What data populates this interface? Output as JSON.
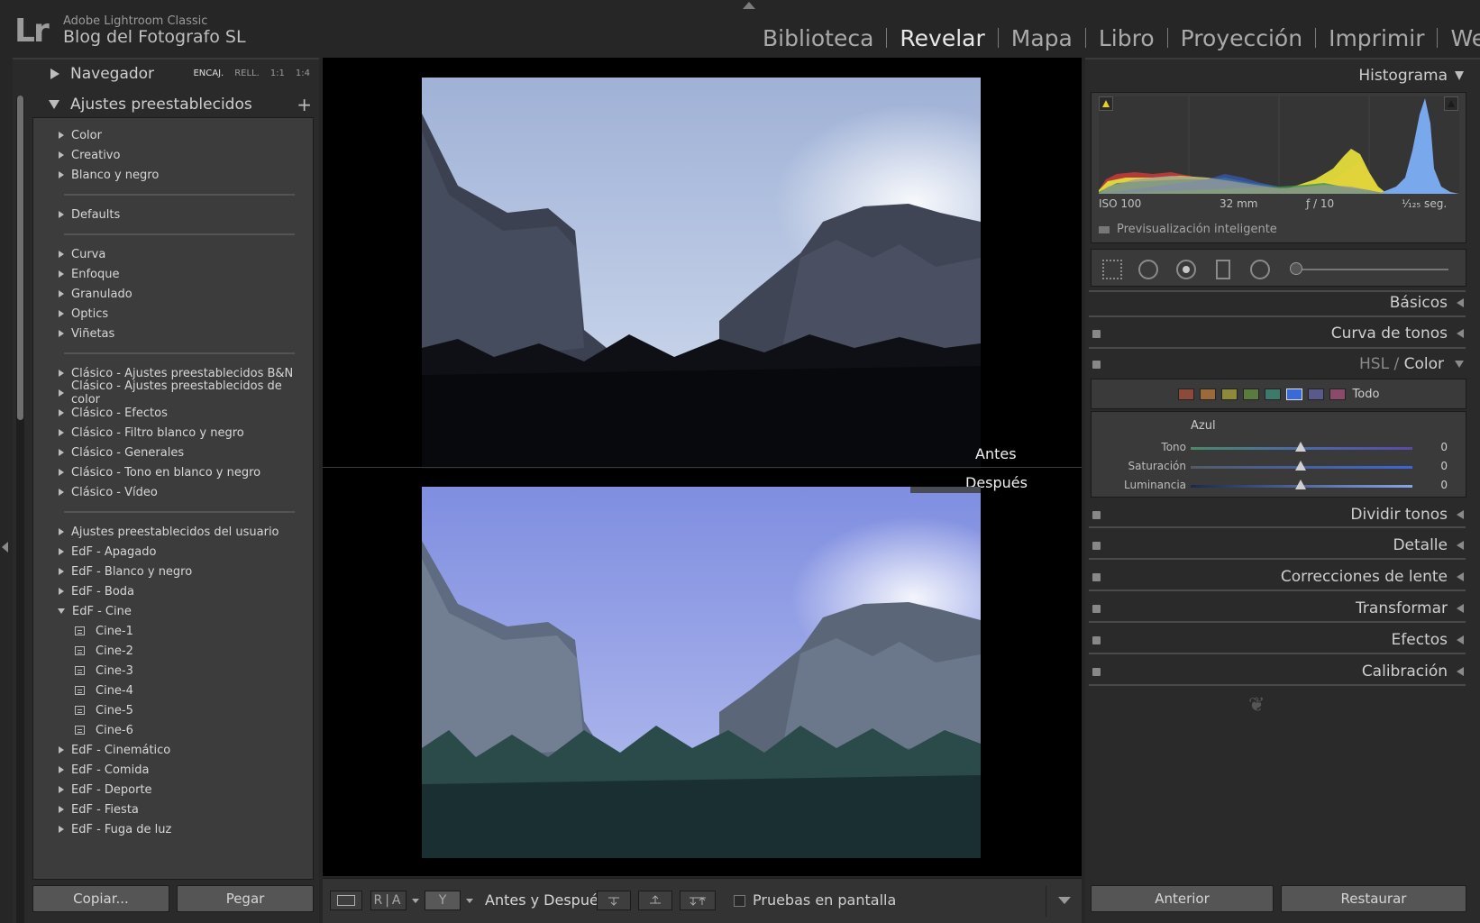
{
  "app": {
    "logo": "Lr",
    "name": "Adobe Lightroom Classic",
    "catalog": "Blog del Fotografo SL"
  },
  "modules": [
    {
      "label": "Biblioteca",
      "active": false
    },
    {
      "label": "Revelar",
      "active": true
    },
    {
      "label": "Mapa",
      "active": false
    },
    {
      "label": "Libro",
      "active": false
    },
    {
      "label": "Proyección",
      "active": false
    },
    {
      "label": "Imprimir",
      "active": false
    },
    {
      "label": "Web",
      "active": false
    }
  ],
  "left": {
    "navigator": {
      "title": "Navegador",
      "zoom_options": [
        "ENCAJ.",
        "RELL.",
        "1:1",
        "1:4"
      ]
    },
    "presets": {
      "title": "Ajustes preestablecidos",
      "plus": "+",
      "groups": [
        [
          "Color",
          "Creativo",
          "Blanco y negro"
        ],
        [
          "Defaults"
        ],
        [
          "Curva",
          "Enfoque",
          "Granulado",
          "Optics",
          "Viñetas"
        ],
        [
          "Clásico - Ajustes preestablecidos B&N",
          "Clásico - Ajustes preestablecidos de color",
          "Clásico - Efectos",
          "Clásico - Filtro blanco y negro",
          "Clásico - Generales",
          "Clásico - Tono en blanco y negro",
          "Clásico - Vídeo"
        ]
      ],
      "user_items": [
        {
          "label": "Ajustes preestablecidos del usuario",
          "kind": "folder"
        },
        {
          "label": "EdF - Apagado",
          "kind": "folder"
        },
        {
          "label": "EdF - Blanco y negro",
          "kind": "folder"
        },
        {
          "label": "EdF - Boda",
          "kind": "folder"
        },
        {
          "label": "EdF - Cine",
          "kind": "open"
        },
        {
          "label": "Cine-1",
          "kind": "preset"
        },
        {
          "label": "Cine-2",
          "kind": "preset"
        },
        {
          "label": "Cine-3",
          "kind": "preset"
        },
        {
          "label": "Cine-4",
          "kind": "preset"
        },
        {
          "label": "Cine-5",
          "kind": "preset"
        },
        {
          "label": "Cine-6",
          "kind": "preset"
        },
        {
          "label": "EdF - Cinemático",
          "kind": "folder"
        },
        {
          "label": "EdF - Comida",
          "kind": "folder"
        },
        {
          "label": "EdF - Deporte",
          "kind": "folder"
        },
        {
          "label": "EdF - Fiesta",
          "kind": "folder"
        },
        {
          "label": "EdF - Fuga de luz",
          "kind": "folder"
        }
      ]
    },
    "copy_label": "Copiar...",
    "paste_label": "Pegar"
  },
  "center": {
    "before_label": "Antes",
    "after_label": "Después"
  },
  "toolbar": {
    "ra_label": "R|A",
    "split_label": "Y",
    "before_after_label": "Antes y Después:",
    "proof_label": "Pruebas en pantalla"
  },
  "right": {
    "histogram": {
      "title": "Histograma",
      "iso": "ISO 100",
      "focal": "32 mm",
      "aperture": "ƒ / 10",
      "shutter": "¹⁄₁₂₅ seg.",
      "smart_preview": "Previsualización inteligente"
    },
    "sections": {
      "basicos": "Básicos",
      "curva": "Curva de tonos",
      "hsl": "HSL",
      "hsl_sep": " / ",
      "color": "Color",
      "dividir": "Dividir tonos",
      "detalle": "Detalle",
      "correcciones": "Correcciones de lente",
      "transformar": "Transformar",
      "efectos": "Efectos",
      "calibracion": "Calibración"
    },
    "hsl_panel": {
      "swatch_colors": [
        "#8c4a3a",
        "#9a6a3a",
        "#8f8a3a",
        "#5a7a3e",
        "#3e7a6a",
        "#3a6ad8",
        "#5a5a8a",
        "#8a4a6a"
      ],
      "todo": "Todo",
      "channel": "Azul",
      "sliders": [
        {
          "label": "Tono",
          "value": "0"
        },
        {
          "label": "Saturación",
          "value": "0"
        },
        {
          "label": "Luminancia",
          "value": "0"
        }
      ]
    },
    "prev_label": "Anterior",
    "reset_label": "Restaurar"
  }
}
